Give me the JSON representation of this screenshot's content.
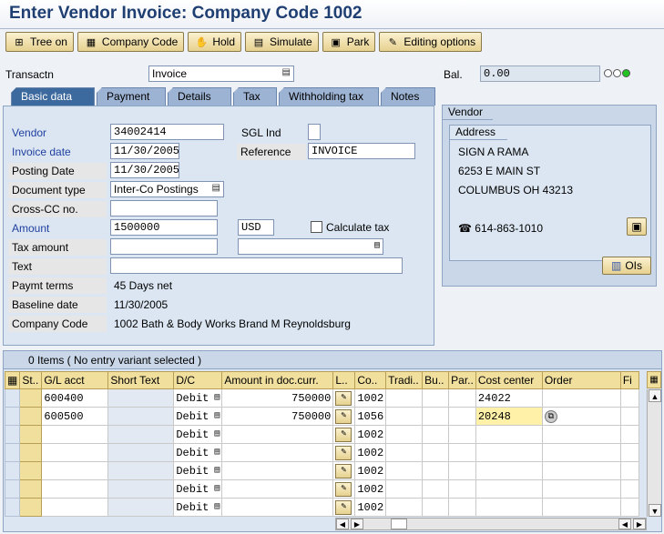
{
  "title": "Enter Vendor Invoice: Company Code 1002",
  "toolbar": [
    {
      "label": "Tree on",
      "icon": "tree-icon"
    },
    {
      "label": "Company Code",
      "icon": "company-code-icon"
    },
    {
      "label": "Hold",
      "icon": "hold-icon"
    },
    {
      "label": "Simulate",
      "icon": "simulate-icon"
    },
    {
      "label": "Park",
      "icon": "park-icon"
    },
    {
      "label": "Editing options",
      "icon": "pencil-icon"
    }
  ],
  "header": {
    "transactn_label": "Transactn",
    "transactn_value": "Invoice",
    "bal_label": "Bal.",
    "bal_value": "0.00",
    "traffic_colors": [
      "#ffffff",
      "#ffffff",
      "#22c322"
    ]
  },
  "tabs": [
    "Basic data",
    "Payment",
    "Details",
    "Tax",
    "Withholding tax",
    "Notes"
  ],
  "basic": {
    "vendor_label": "Vendor",
    "vendor_value": "34002414",
    "sgl_label": "SGL Ind",
    "sgl_value": "",
    "invoice_date_label": "Invoice date",
    "invoice_date_value": "11/30/2005",
    "reference_label": "Reference",
    "reference_value": "INVOICE",
    "posting_date_label": "Posting Date",
    "posting_date_value": "11/30/2005",
    "doc_type_label": "Document type",
    "doc_type_value": "Inter-Co Postings",
    "cross_cc_label": "Cross-CC no.",
    "cross_cc_value": "",
    "amount_label": "Amount",
    "amount_value": "1500000",
    "currency_value": "USD",
    "calc_tax_label": "Calculate tax",
    "tax_amount_label": "Tax amount",
    "tax_amount_value": "",
    "tax_code_value": "",
    "text_label": "Text",
    "text_value": "",
    "paymt_terms_label": "Paymt terms",
    "paymt_terms_value": "45 Days net",
    "baseline_label": "Baseline date",
    "baseline_value": "11/30/2005",
    "company_code_label": "Company Code",
    "company_code_value": "1002 Bath & Body Works Brand M Reynoldsburg"
  },
  "vendor_box": {
    "tab": "Vendor",
    "address_tab": "Address",
    "line1": "SIGN A RAMA",
    "line2": "6253 E MAIN ST",
    "line3": "COLUMBUS OH  43213",
    "phone": "614-863-1010",
    "ois_label": "OIs"
  },
  "grid": {
    "title": "0 Items ( No entry variant selected )",
    "columns": [
      "St..",
      "G/L acct",
      "Short Text",
      "D/C",
      "Amount in doc.curr.",
      "L..",
      "Co..",
      "Tradi..",
      "Bu..",
      "Par..",
      "Cost center",
      "Order",
      "Fi"
    ],
    "rows": [
      {
        "gl": "600400",
        "short": "",
        "dc": "Debit",
        "amount": "750000",
        "co": "1002",
        "cost": "24022",
        "order": ""
      },
      {
        "gl": "600500",
        "short": "",
        "dc": "Debit",
        "amount": "750000",
        "co": "1056",
        "cost": "20248",
        "order": ""
      },
      {
        "gl": "",
        "short": "",
        "dc": "Debit",
        "amount": "",
        "co": "1002",
        "cost": "",
        "order": ""
      },
      {
        "gl": "",
        "short": "",
        "dc": "Debit",
        "amount": "",
        "co": "1002",
        "cost": "",
        "order": ""
      },
      {
        "gl": "",
        "short": "",
        "dc": "Debit",
        "amount": "",
        "co": "1002",
        "cost": "",
        "order": ""
      },
      {
        "gl": "",
        "short": "",
        "dc": "Debit",
        "amount": "",
        "co": "1002",
        "cost": "",
        "order": ""
      },
      {
        "gl": "",
        "short": "",
        "dc": "Debit",
        "amount": "",
        "co": "1002",
        "cost": "",
        "order": ""
      }
    ]
  }
}
